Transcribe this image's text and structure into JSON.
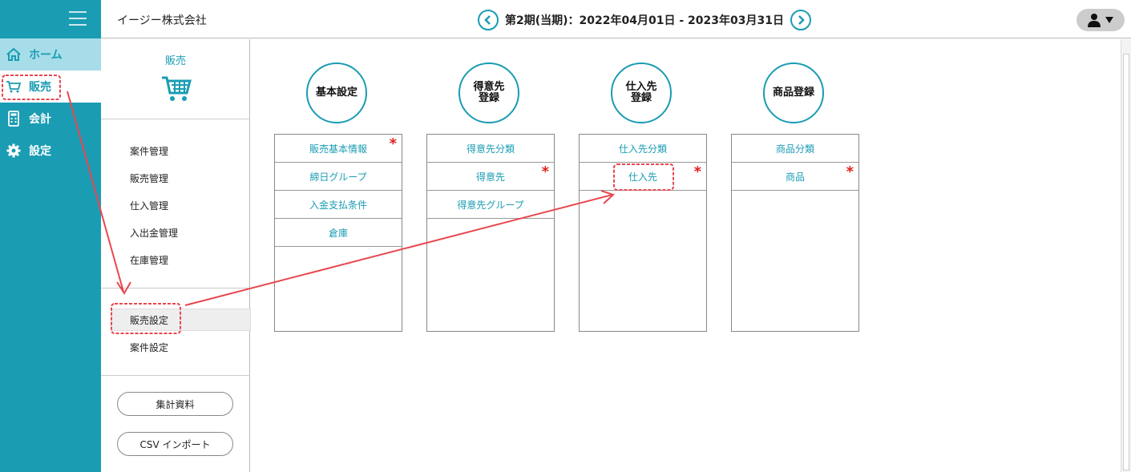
{
  "header": {
    "company": "イージー株式会社",
    "period": "第2期(当期)：2022年04月01日 - 2023年03月31日"
  },
  "nav": [
    {
      "label": "ホーム",
      "icon": "home-icon"
    },
    {
      "label": "販売",
      "icon": "cart-icon"
    },
    {
      "label": "会計",
      "icon": "calculator-icon"
    },
    {
      "label": "設定",
      "icon": "gear-icon"
    }
  ],
  "subnav": {
    "title": "販売",
    "items": [
      "案件管理",
      "販売管理",
      "仕入管理",
      "入出金管理",
      "在庫管理"
    ],
    "settings": [
      "販売設定",
      "案件設定"
    ],
    "buttons": [
      "集計資料",
      "CSV インポート"
    ]
  },
  "columns": [
    {
      "title": "基本設定",
      "items": [
        {
          "label": "販売基本情報",
          "required": "*"
        },
        {
          "label": "締日グループ"
        },
        {
          "label": "入金支払条件"
        },
        {
          "label": "倉庫"
        }
      ]
    },
    {
      "title": "得意先\n登録",
      "items": [
        {
          "label": "得意先分類"
        },
        {
          "label": "得意先",
          "required": "*"
        },
        {
          "label": "得意先グループ"
        }
      ]
    },
    {
      "title": "仕入先\n登録",
      "items": [
        {
          "label": "仕入先分類"
        },
        {
          "label": "仕入先",
          "required": "*"
        }
      ]
    },
    {
      "title": "商品登録",
      "items": [
        {
          "label": "商品分類"
        },
        {
          "label": "商品",
          "required": "*"
        }
      ]
    }
  ],
  "colors": {
    "accent": "#1a9cb3",
    "required": "#e0201c",
    "annotation": "#e8474f"
  }
}
